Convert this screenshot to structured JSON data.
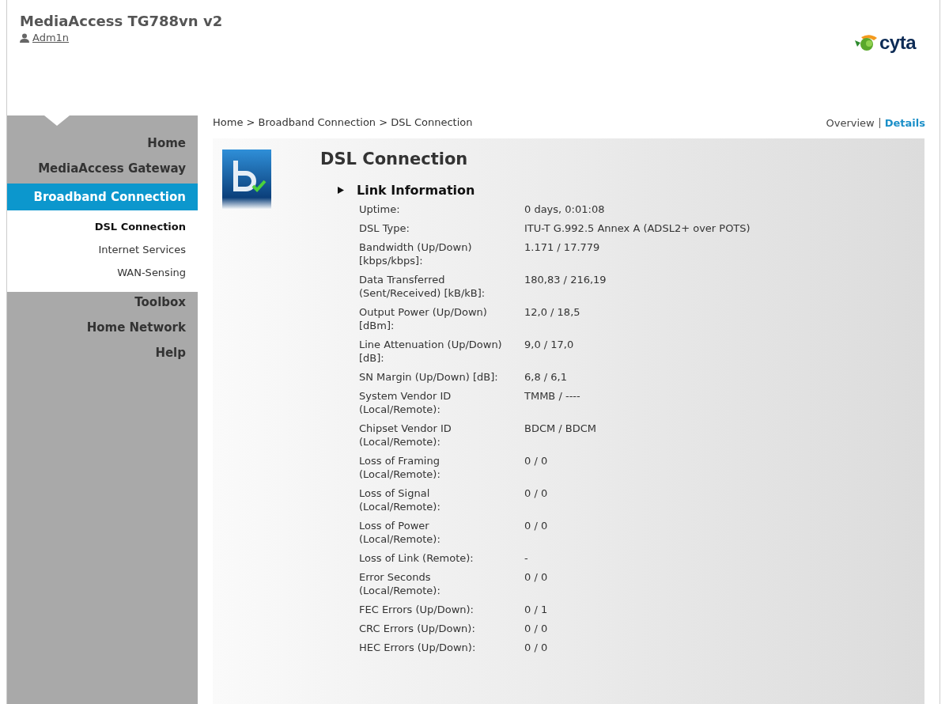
{
  "header": {
    "title": "MediaAccess TG788vn v2",
    "user": "Adm1n",
    "logo_text": "cyta"
  },
  "nav": [
    {
      "label": "Home",
      "selected": false
    },
    {
      "label": "MediaAccess Gateway",
      "selected": false
    },
    {
      "label": "Broadband Connection",
      "selected": true,
      "children": [
        {
          "label": "DSL Connection",
          "selected": true
        },
        {
          "label": "Internet Services",
          "selected": false
        },
        {
          "label": "WAN-Sensing",
          "selected": false
        }
      ]
    },
    {
      "label": "Toolbox",
      "selected": false
    },
    {
      "label": "Home Network",
      "selected": false
    },
    {
      "label": "Help",
      "selected": false
    }
  ],
  "breadcrumb": "Home > Broadband Connection > DSL Connection",
  "views": [
    {
      "label": "Overview",
      "selected": false
    },
    {
      "label": "Details",
      "selected": true
    }
  ],
  "panel": {
    "title": "DSL Connection",
    "section": "Link Information",
    "expanded": true,
    "rows": [
      {
        "label": "Uptime:",
        "value": "0 days, 0:01:08"
      },
      {
        "label": "DSL Type:",
        "value": "ITU-T G.992.5 Annex A (ADSL2+ over POTS)"
      },
      {
        "label": "Bandwidth (Up/Down) [kbps/kbps]:",
        "value": "1.171 / 17.779"
      },
      {
        "label": "Data Transferred (Sent/Received) [kB/kB]:",
        "value": "180,83 / 216,19"
      },
      {
        "label": "Output Power (Up/Down) [dBm]:",
        "value": "12,0 / 18,5"
      },
      {
        "label": "Line Attenuation (Up/Down) [dB]:",
        "value": "9,0 / 17,0"
      },
      {
        "label": "SN Margin (Up/Down) [dB]:",
        "value": "6,8 / 6,1"
      },
      {
        "label": "System Vendor ID (Local/Remote):",
        "value": "TMMB / ----"
      },
      {
        "label": "Chipset Vendor ID (Local/Remote):",
        "value": "BDCM / BDCM"
      },
      {
        "label": "Loss of Framing (Local/Remote):",
        "value": "0 / 0"
      },
      {
        "label": "Loss of Signal (Local/Remote):",
        "value": "0 / 0"
      },
      {
        "label": "Loss of Power (Local/Remote):",
        "value": "0 / 0"
      },
      {
        "label": "Loss of Link (Remote):",
        "value": "-"
      },
      {
        "label": "Error Seconds (Local/Remote):",
        "value": "0 / 0"
      },
      {
        "label": "FEC Errors (Up/Down):",
        "value": "0 / 1"
      },
      {
        "label": "CRC Errors (Up/Down):",
        "value": "0 / 0"
      },
      {
        "label": "HEC Errors (Up/Down):",
        "value": "0 / 0"
      }
    ]
  }
}
